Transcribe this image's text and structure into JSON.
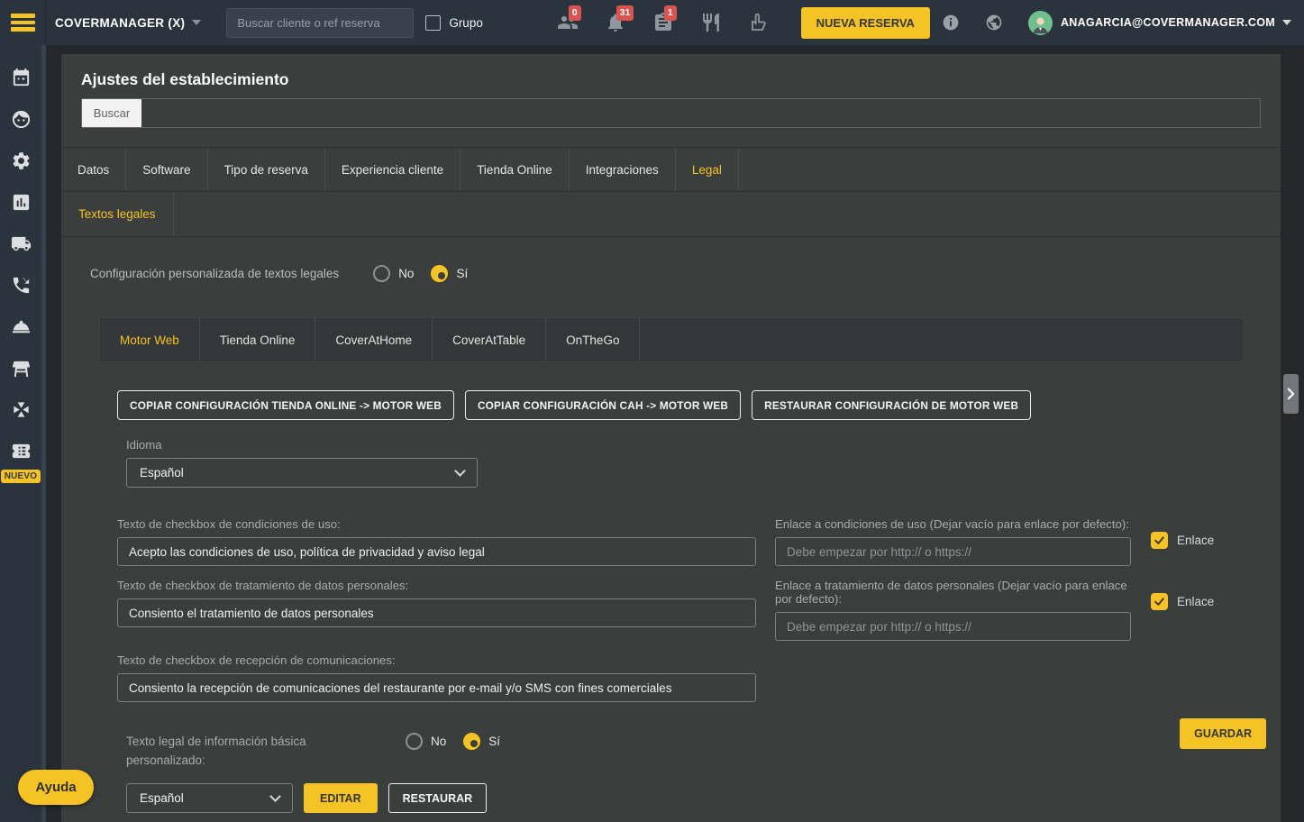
{
  "topbar": {
    "brand": "COVERMANAGER (X)",
    "search_placeholder": "Buscar cliente o ref reserva",
    "grupo_label": "Grupo",
    "badge_guests": "0",
    "badge_notifications": "31",
    "badge_tasks": "1",
    "nueva_reserva_label": "NUEVA RESERVA",
    "user_email": "ANAGARCIA@COVERMANAGER.COM",
    "icon_names": [
      "guests-icon",
      "bell-icon",
      "clipboard-icon",
      "restaurant-icon",
      "hand-icon",
      "info-icon",
      "globe-icon"
    ]
  },
  "sidebar": {
    "nuevo_badge": "NUEVO",
    "ayuda_label": "Ayuda",
    "icon_names": [
      "calendar-icon",
      "customer-face-icon",
      "gear-icon",
      "reports-icon",
      "delivery-truck-icon",
      "phone-icon",
      "room-service-icon",
      "table-icon",
      "cross-selling-icon",
      "ticket-icon"
    ]
  },
  "page": {
    "title": "Ajustes del establecimiento",
    "search_button": "Buscar"
  },
  "tabs": [
    {
      "label": "Datos"
    },
    {
      "label": "Software"
    },
    {
      "label": "Tipo de reserva"
    },
    {
      "label": "Experiencia cliente"
    },
    {
      "label": "Tienda Online"
    },
    {
      "label": "Integraciones"
    },
    {
      "label": "Legal"
    }
  ],
  "subtabs": [
    {
      "label": "Textos legales"
    }
  ],
  "legal": {
    "custom_label": "Configuración personalizada de textos legales",
    "radio_no": "No",
    "radio_yes": "Sí",
    "channel_tabs": [
      {
        "label": "Motor Web"
      },
      {
        "label": "Tienda Online"
      },
      {
        "label": "CoverAtHome"
      },
      {
        "label": "CoverAtTable"
      },
      {
        "label": "OnTheGo"
      }
    ],
    "actions": [
      {
        "label": "COPIAR CONFIGURACIÓN TIENDA ONLINE -> MOTOR WEB"
      },
      {
        "label": "COPIAR CONFIGURACIÓN CAH -> MOTOR WEB"
      },
      {
        "label": "RESTAURAR CONFIGURACIÓN DE MOTOR WEB"
      }
    ],
    "idioma_label": "Idioma",
    "idioma_value": "Español",
    "conditions": {
      "label": "Texto de checkbox de condiciones de uso:",
      "value": "Acepto las condiciones de uso, política de privacidad y aviso legal",
      "link_label": "Enlace a condiciones de uso (Dejar vacío para enlace por defecto):",
      "link_placeholder": "Debe empezar por http:// o https://",
      "enlace_label": "Enlace"
    },
    "personal_data": {
      "label": "Texto de checkbox de tratamiento de datos personales:",
      "value": "Consiento el tratamiento de datos personales",
      "link_label": "Enlace a tratamiento de datos personales (Dejar vacío para enlace por defecto):",
      "link_placeholder": "Debe empezar por http:// o https://",
      "enlace_label": "Enlace"
    },
    "communications": {
      "label": "Texto de checkbox de recepción de comunicaciones:",
      "value": "Consiento la recepción de comunicaciones del restaurante por e-mail y/o SMS con fines comerciales"
    },
    "basic_info": {
      "label": "Texto legal de información básica personalizado:",
      "radio_no": "No",
      "radio_yes": "Sí",
      "language_value": "Español",
      "editar_label": "EDITAR",
      "restaurar_label": "RESTAURAR"
    },
    "guardar_label": "GUARDAR"
  },
  "colors": {
    "accent_yellow": "#f5c325",
    "badge_red": "#d9534f",
    "topbar_bg": "#2b333c",
    "panel_bg": "#3a3e3d"
  }
}
